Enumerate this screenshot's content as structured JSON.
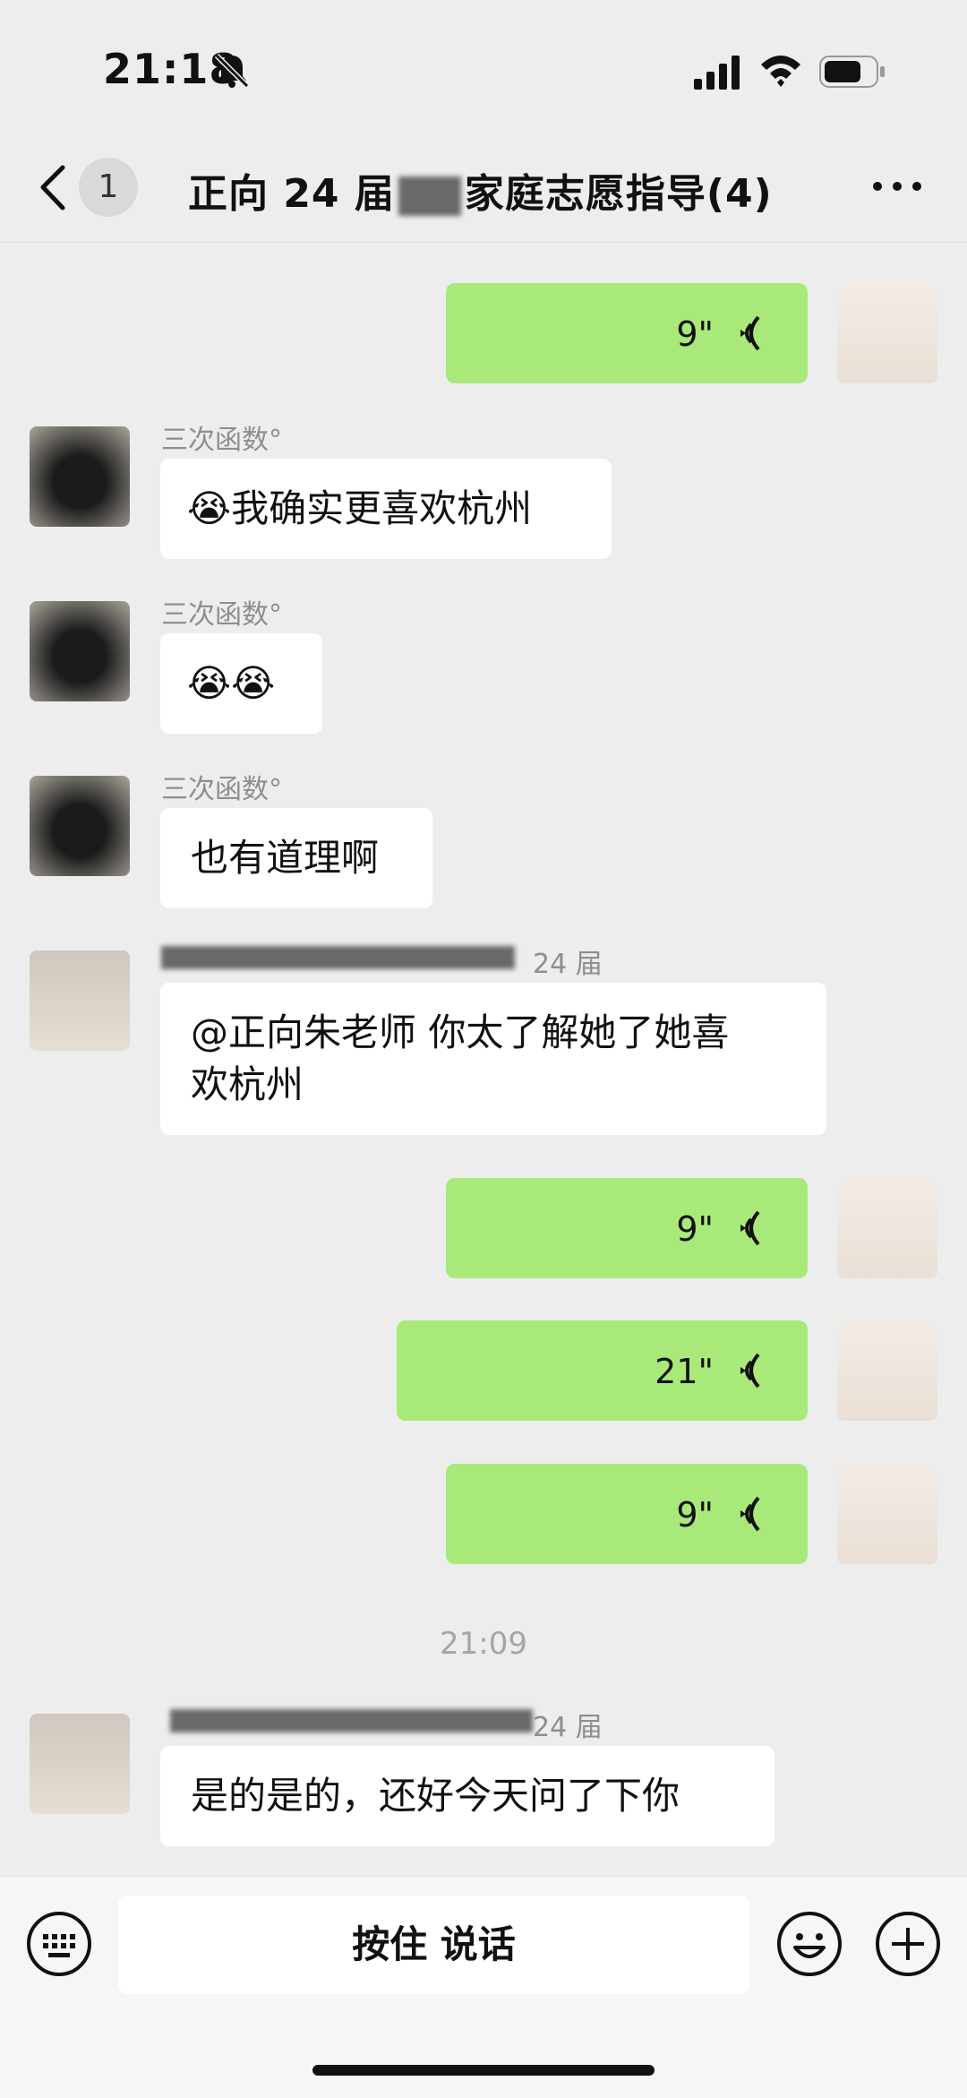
{
  "status_bar": {
    "time": "21:18",
    "icons": [
      "bell-muted-icon",
      "cellular-signal-icon",
      "wifi-icon",
      "battery-icon"
    ]
  },
  "header": {
    "unread_count": "1",
    "title_part1": "正向 24 届",
    "title_part2": "家庭志愿指导(4)",
    "icons": [
      "chevron-left-icon",
      "more-icon"
    ]
  },
  "messages": [
    {
      "type": "voice",
      "dir": "out",
      "duration": "9\""
    },
    {
      "type": "text",
      "dir": "in",
      "sender": "三次函数°",
      "text": "我确实更喜欢杭州"
    },
    {
      "type": "emoji",
      "dir": "in",
      "sender": "三次函数°"
    },
    {
      "type": "text",
      "dir": "in",
      "sender": "三次函数°",
      "text": "也有道理啊"
    },
    {
      "type": "text",
      "dir": "in",
      "sender_suffix": "24 届",
      "line1": "@正向朱老师 你太了解她了她喜",
      "line2": "欢杭州"
    },
    {
      "type": "voice",
      "dir": "out",
      "duration": "9\""
    },
    {
      "type": "voice",
      "dir": "out",
      "duration": "21\""
    },
    {
      "type": "voice",
      "dir": "out",
      "duration": "9\""
    },
    {
      "type": "time",
      "text": "21:09"
    },
    {
      "type": "text",
      "dir": "in",
      "sender_suffix": "24 届",
      "text": "是的是的，还好今天问了下你"
    }
  ],
  "input_bar": {
    "hold_to_talk": "按住 说话",
    "icons": [
      "keyboard-icon",
      "emoji-icon",
      "plus-icon"
    ]
  },
  "colors": {
    "outgoing_bubble": "#a9e97a",
    "incoming_bubble": "#ffffff",
    "background": "#ededed"
  }
}
